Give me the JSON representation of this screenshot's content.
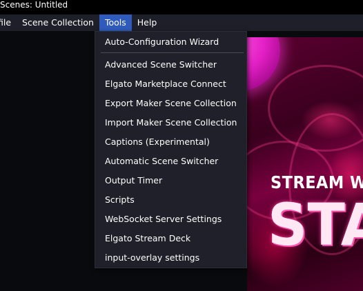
{
  "window": {
    "title": "Scenes: Untitled"
  },
  "menubar": {
    "items": [
      "file",
      "Scene Collection",
      "Tools",
      "Help"
    ],
    "active": "Tools"
  },
  "tools_menu": {
    "items": [
      "Auto-Configuration Wizard",
      "Advanced Scene Switcher",
      "Elgato Marketplace Connect",
      "Export Maker Scene Collection",
      "Import Maker Scene Collection",
      "Captions (Experimental)",
      "Automatic Scene Switcher",
      "Output Timer",
      "Scripts",
      "WebSocket Server Settings",
      "Elgato Stream Deck",
      "input-overlay settings"
    ]
  },
  "preview": {
    "headline": "STREAM W",
    "big_text": "STA"
  },
  "colors": {
    "menubar_bg": "#1e1f29",
    "menu_active": "#2f5bbd",
    "dropdown_bg": "#1f2029",
    "accent_pink": "#ff3fa0"
  }
}
